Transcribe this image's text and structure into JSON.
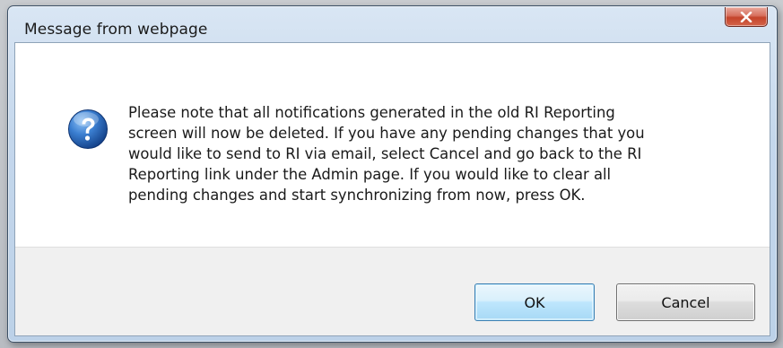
{
  "dialog": {
    "title": "Message from webpage",
    "close_icon": "close-icon",
    "icon": "question-icon",
    "message_lines": [
      "Please note that all notifications generated in the old RI Reporting",
      "screen will now be deleted. If you have any pending changes that you",
      "would like to send to RI via email, select Cancel and go back to the RI",
      "Reporting link under the Admin page. If you would like to clear all",
      "pending changes and start synchronizing from now, press OK."
    ],
    "ok_label": "OK",
    "cancel_label": "Cancel"
  },
  "colors": {
    "titlebar": "#c4d7ec",
    "close_button": "#c4442b",
    "question_icon": "#1f5aa8",
    "button_area": "#f0f0f0",
    "ok_focus_border": "#3c7fb1"
  }
}
